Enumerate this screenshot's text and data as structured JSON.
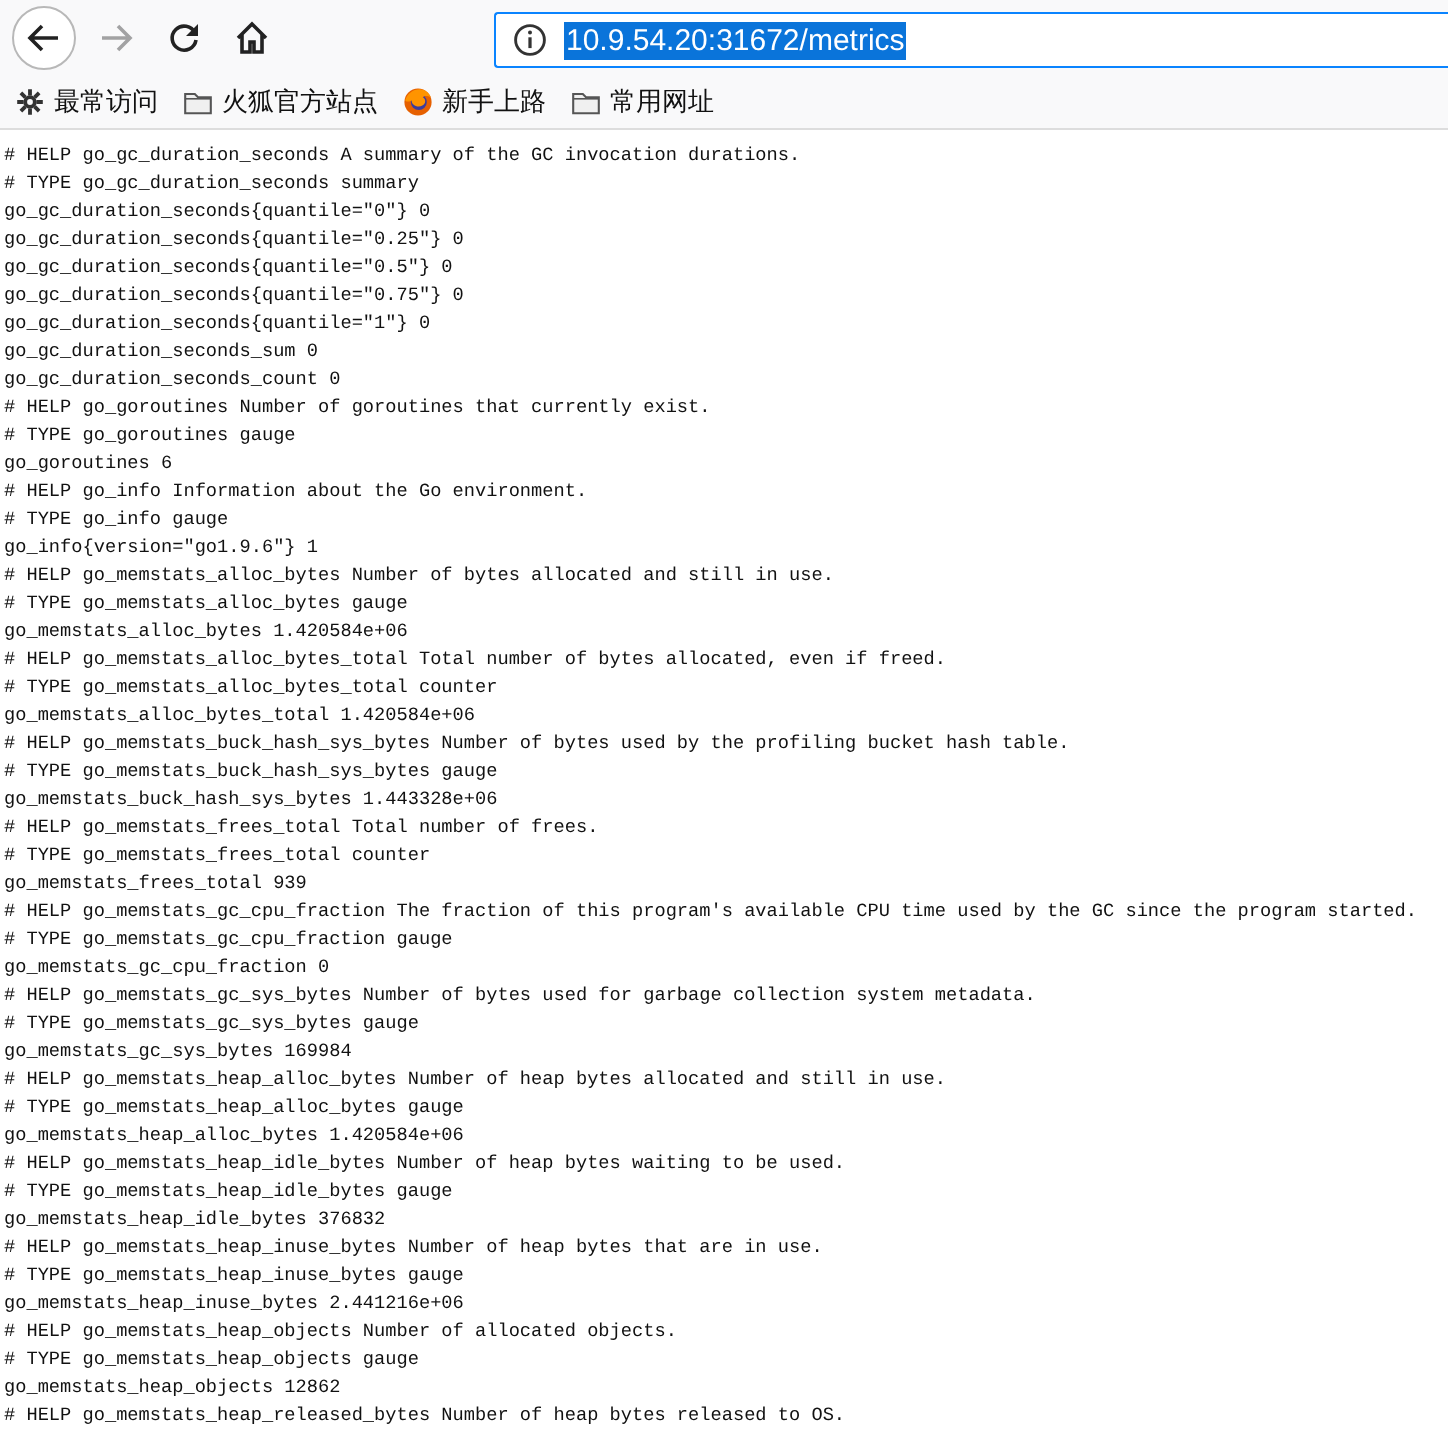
{
  "toolbar": {
    "buttons": [
      {
        "kind": "back",
        "disabled": false
      },
      {
        "kind": "forward",
        "disabled": true
      },
      {
        "kind": "reload",
        "disabled": false
      },
      {
        "kind": "home",
        "disabled": false
      }
    ],
    "address": {
      "url": "10.9.54.20:31672/metrics",
      "selected": true
    }
  },
  "bookmarks": [
    {
      "kind": "gear",
      "label": "最常访问"
    },
    {
      "kind": "folder",
      "label": "火狐官方站点"
    },
    {
      "kind": "browser",
      "label": "新手上路"
    },
    {
      "kind": "folder",
      "label": "常用网址"
    }
  ],
  "lines": [
    "# HELP go_gc_duration_seconds A summary of the GC invocation durations.",
    "# TYPE go_gc_duration_seconds summary",
    "go_gc_duration_seconds{quantile=\"0\"} 0",
    "go_gc_duration_seconds{quantile=\"0.25\"} 0",
    "go_gc_duration_seconds{quantile=\"0.5\"} 0",
    "go_gc_duration_seconds{quantile=\"0.75\"} 0",
    "go_gc_duration_seconds{quantile=\"1\"} 0",
    "go_gc_duration_seconds_sum 0",
    "go_gc_duration_seconds_count 0",
    "# HELP go_goroutines Number of goroutines that currently exist.",
    "# TYPE go_goroutines gauge",
    "go_goroutines 6",
    "# HELP go_info Information about the Go environment.",
    "# TYPE go_info gauge",
    "go_info{version=\"go1.9.6\"} 1",
    "# HELP go_memstats_alloc_bytes Number of bytes allocated and still in use.",
    "# TYPE go_memstats_alloc_bytes gauge",
    "go_memstats_alloc_bytes 1.420584e+06",
    "# HELP go_memstats_alloc_bytes_total Total number of bytes allocated, even if freed.",
    "# TYPE go_memstats_alloc_bytes_total counter",
    "go_memstats_alloc_bytes_total 1.420584e+06",
    "# HELP go_memstats_buck_hash_sys_bytes Number of bytes used by the profiling bucket hash table.",
    "# TYPE go_memstats_buck_hash_sys_bytes gauge",
    "go_memstats_buck_hash_sys_bytes 1.443328e+06",
    "# HELP go_memstats_frees_total Total number of frees.",
    "# TYPE go_memstats_frees_total counter",
    "go_memstats_frees_total 939",
    "# HELP go_memstats_gc_cpu_fraction The fraction of this program's available CPU time used by the GC since the program started.",
    "# TYPE go_memstats_gc_cpu_fraction gauge",
    "go_memstats_gc_cpu_fraction 0",
    "# HELP go_memstats_gc_sys_bytes Number of bytes used for garbage collection system metadata.",
    "# TYPE go_memstats_gc_sys_bytes gauge",
    "go_memstats_gc_sys_bytes 169984",
    "# HELP go_memstats_heap_alloc_bytes Number of heap bytes allocated and still in use.",
    "# TYPE go_memstats_heap_alloc_bytes gauge",
    "go_memstats_heap_alloc_bytes 1.420584e+06",
    "# HELP go_memstats_heap_idle_bytes Number of heap bytes waiting to be used.",
    "# TYPE go_memstats_heap_idle_bytes gauge",
    "go_memstats_heap_idle_bytes 376832",
    "# HELP go_memstats_heap_inuse_bytes Number of heap bytes that are in use.",
    "# TYPE go_memstats_heap_inuse_bytes gauge",
    "go_memstats_heap_inuse_bytes 2.441216e+06",
    "# HELP go_memstats_heap_objects Number of allocated objects.",
    "# TYPE go_memstats_heap_objects gauge",
    "go_memstats_heap_objects 12862",
    "# HELP go_memstats_heap_released_bytes Number of heap bytes released to OS."
  ]
}
